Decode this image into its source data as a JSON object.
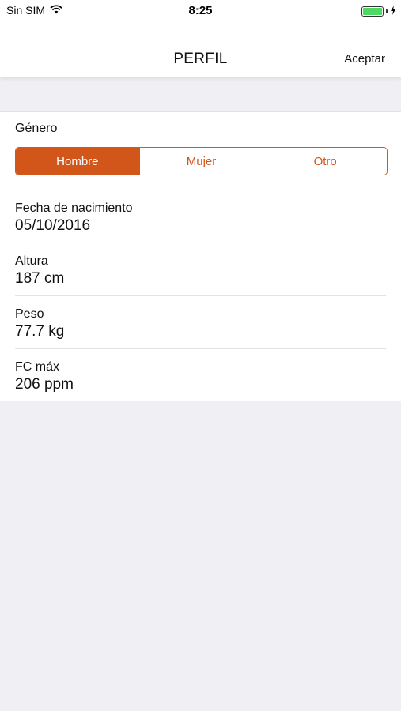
{
  "status": {
    "carrier": "Sin SIM",
    "time": "8:25",
    "wifi_icon": "wifi-icon",
    "battery_icon": "battery-icon",
    "charging_icon": "bolt-icon"
  },
  "nav": {
    "title": "PERFIL",
    "accept_label": "Aceptar"
  },
  "colors": {
    "accent": "#d2561a",
    "background": "#efeff4"
  },
  "gender": {
    "label": "Género",
    "options": [
      "Hombre",
      "Mujer",
      "Otro"
    ],
    "selected": "Hombre"
  },
  "fields": [
    {
      "label": "Fecha de nacimiento",
      "value": "05/10/2016"
    },
    {
      "label": "Altura",
      "value": "187 cm"
    },
    {
      "label": "Peso",
      "value": "77.7 kg"
    },
    {
      "label": "FC máx",
      "value": "206 ppm"
    }
  ]
}
